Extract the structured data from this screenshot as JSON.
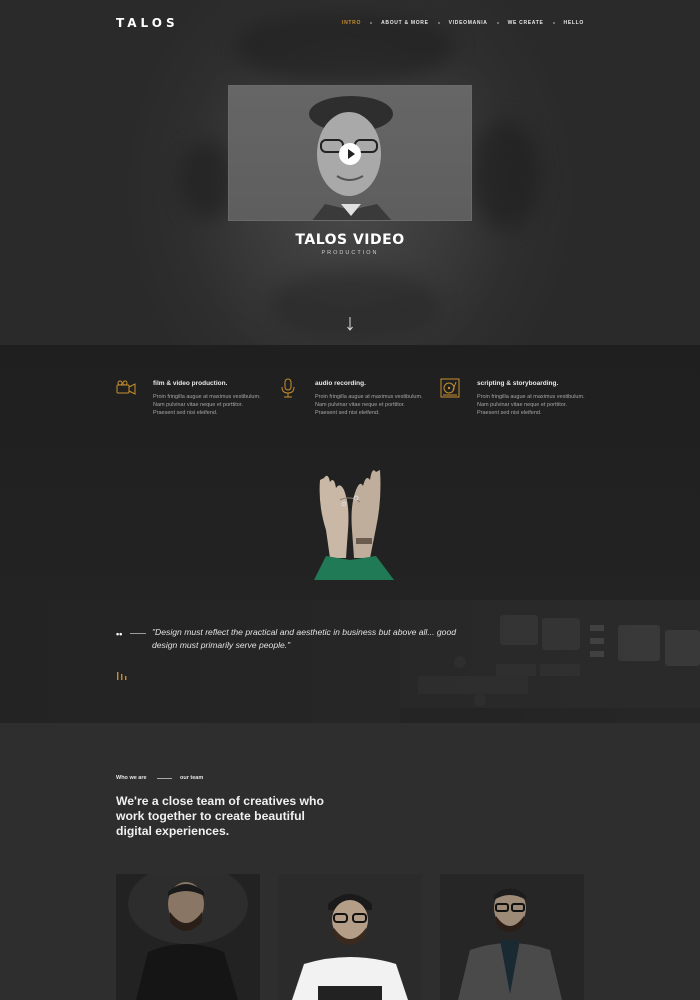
{
  "nav": {
    "logo": "TALOS",
    "items": [
      {
        "label": "INTRO"
      },
      {
        "label": "ABOUT & MORE"
      },
      {
        "label": "VIDEOMANIA"
      },
      {
        "label": "WE CREATE"
      },
      {
        "label": "HELLO"
      }
    ]
  },
  "hero": {
    "title": "TALOS VIDEO",
    "subtitle": "PRODUCTION"
  },
  "services": [
    {
      "icon": "video-camera-icon",
      "title": "film & video production.",
      "text": "Proin fringilla augue at maximus vestibulum. Nam pulvinar vitae neque et porttitor. Praesent sed nisi eleifend."
    },
    {
      "icon": "microphone-icon",
      "title": "audio recording.",
      "text": "Proin fringilla augue at maximus vestibulum. Nam pulvinar vitae neque et porttitor. Praesent sed nisi eleifend."
    },
    {
      "icon": "turntable-icon",
      "title": "scripting & storyboarding.",
      "text": "Proin fringilla augue at maximus vestibulum. Nam pulvinar vitae neque et porttitor. Praesent sed nisi eleifend."
    }
  ],
  "quote": {
    "marks": "••",
    "text": "\"Design must reflect the practical and aesthetic in business but above all... good design must primarily serve people.\""
  },
  "team": {
    "label_left": "Who we are",
    "label_right": "our team",
    "heading": "We're a close team of creatives who work together to create beautiful digital experiences."
  },
  "colors": {
    "accent": "#c8902e",
    "background": "#2b2b2b",
    "text": "#ffffff"
  }
}
